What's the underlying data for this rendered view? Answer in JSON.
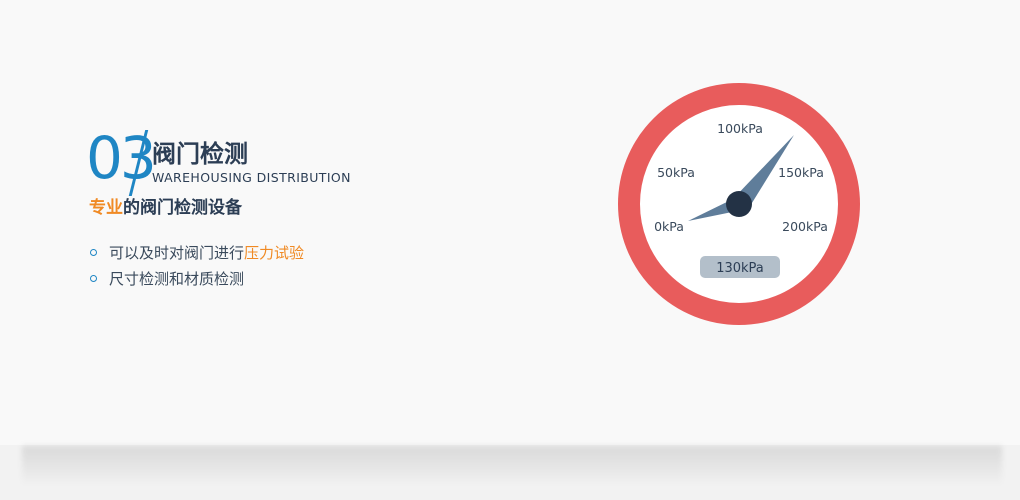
{
  "section": {
    "number": "03",
    "title": "阀门检测",
    "subtitle": "WAREHOUSING  DISTRIBUTION",
    "tagline_highlight": "专业",
    "tagline_rest": "的阀门检测设备"
  },
  "features": [
    {
      "text": "可以及时对阀门进行",
      "highlight": "压力试验"
    },
    {
      "text": "尺寸检测和材质检测",
      "highlight": ""
    }
  ],
  "gauge": {
    "labels": [
      "0kPa",
      "50kPa",
      "100kPa",
      "150kPa",
      "200kPa"
    ],
    "reading": "130kPa",
    "value_kpa": 130,
    "colors": {
      "ring": "#e85c5c",
      "face": "#ffffff",
      "needle": "#5f7d9a",
      "hub": "#233245",
      "reading_bg": "#b3bfca"
    }
  },
  "colors": {
    "accent": "#f08a24",
    "primary": "#1f86c4",
    "text": "#2c3e55"
  }
}
